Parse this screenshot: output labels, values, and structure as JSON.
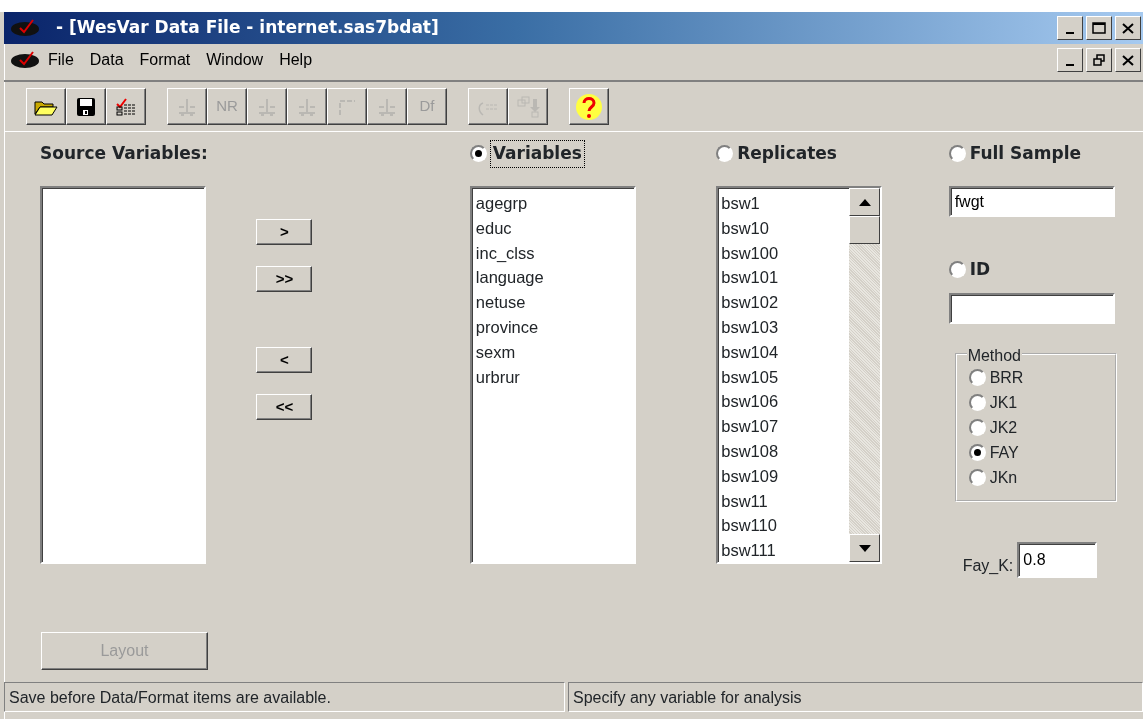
{
  "window": {
    "title": "- [WesVar Data File - internet.sas7bdat]"
  },
  "menu": [
    "File",
    "Data",
    "Format",
    "Window",
    "Help"
  ],
  "toolbar": [
    [
      {
        "kind": "open",
        "disabled": false
      },
      {
        "kind": "save",
        "disabled": false
      },
      {
        "kind": "checklist",
        "disabled": false
      }
    ],
    [
      {
        "kind": "scale",
        "disabled": true
      },
      {
        "kind": "text",
        "label": "NR",
        "disabled": true
      },
      {
        "kind": "scale",
        "disabled": true
      },
      {
        "kind": "scale",
        "disabled": true
      },
      {
        "kind": "corner",
        "disabled": true
      },
      {
        "kind": "scale",
        "disabled": true
      },
      {
        "kind": "text",
        "label": "Df",
        "disabled": true
      }
    ],
    [
      {
        "kind": "arrow",
        "disabled": true
      },
      {
        "kind": "copy",
        "disabled": true
      }
    ],
    [
      {
        "kind": "help",
        "disabled": false
      }
    ]
  ],
  "source_variables": {
    "label": "Source Variables:"
  },
  "move_buttons": [
    ">",
    ">>",
    "<",
    "<<"
  ],
  "variables": {
    "label": "Variables",
    "selected": true,
    "focused": true,
    "items": [
      "agegrp",
      "educ",
      "inc_clss",
      "language",
      "netuse",
      "province",
      "sexm",
      "urbrur"
    ]
  },
  "replicates": {
    "label": "Replicates",
    "selected": false,
    "focused": false,
    "items": [
      "bsw1",
      "bsw10",
      "bsw100",
      "bsw101",
      "bsw102",
      "bsw103",
      "bsw104",
      "bsw105",
      "bsw106",
      "bsw107",
      "bsw108",
      "bsw109",
      "bsw11",
      "bsw110",
      "bsw111"
    ]
  },
  "full_sample": {
    "label": "Full Sample",
    "selected": false,
    "focused": false,
    "value": "fwgt"
  },
  "id": {
    "label": "ID",
    "selected": false,
    "focused": false
  },
  "method": {
    "title": "Method",
    "options": [
      {
        "label": "BRR",
        "selected": false
      },
      {
        "label": "JK1",
        "selected": false
      },
      {
        "label": "JK2",
        "selected": false
      },
      {
        "label": "FAY",
        "selected": true
      },
      {
        "label": "JKn",
        "selected": false
      }
    ]
  },
  "fay_k": {
    "label": "Fay_K:",
    "value": "0.8"
  },
  "layout_button": {
    "label": "Layout",
    "disabled": true
  },
  "status_bar": [
    "Save before Data/Format items are available.",
    "Specify any variable for analysis"
  ]
}
